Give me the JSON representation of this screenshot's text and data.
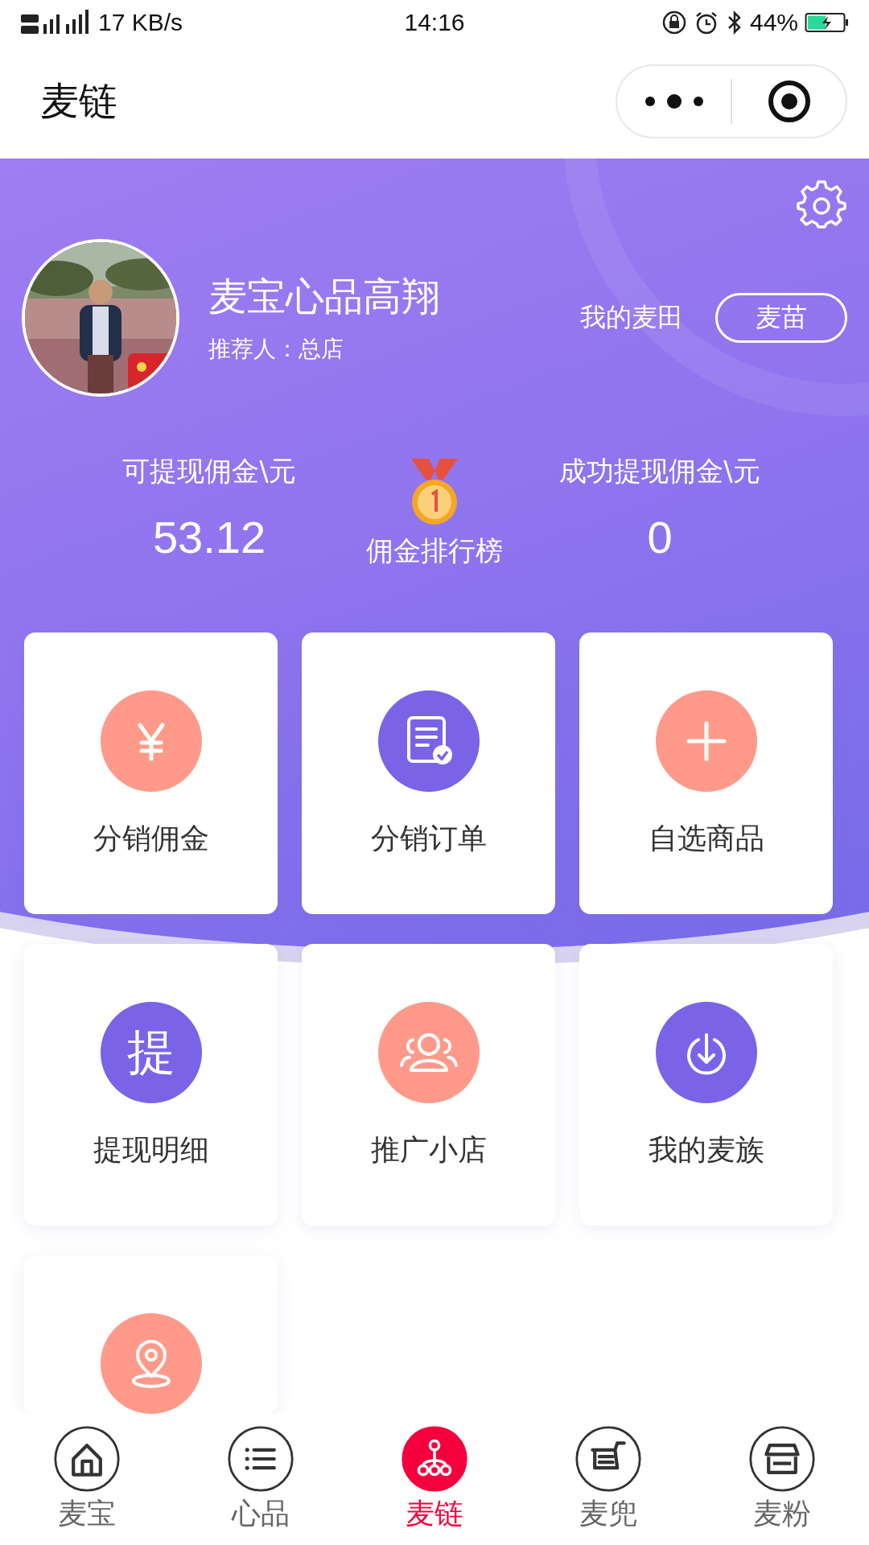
{
  "status_bar": {
    "network": "17 KB/s",
    "time": "14:16",
    "battery": "44%"
  },
  "nav_bar": {
    "title": "麦链"
  },
  "profile": {
    "name": "麦宝心品高翔",
    "referrer": "推荐人：总店",
    "field_label": "我的麦田",
    "level_button": "麦苗"
  },
  "stats": [
    {
      "label": "可提现佣金\\元",
      "value": "53.12"
    },
    {
      "label": "成功提现佣金\\元",
      "value": "0"
    }
  ],
  "ranking": {
    "label": "佣金排行榜"
  },
  "cards": [
    {
      "label": "分销佣金",
      "color": "#ff9a8a"
    },
    {
      "label": "分销订单",
      "color": "#7b63e8"
    },
    {
      "label": "自选商品",
      "color": "#ff9a8a"
    },
    {
      "label": "提现明细",
      "color": "#7b63e8",
      "icon_text": "提"
    },
    {
      "label": "推广小店",
      "color": "#ff9a8a"
    },
    {
      "label": "我的麦族",
      "color": "#7b63e8"
    },
    {
      "color": "#ff9a8a"
    }
  ],
  "tab_bar": [
    {
      "label": "麦宝",
      "selected": false
    },
    {
      "label": "心品",
      "selected": false
    },
    {
      "label": "麦链",
      "selected": true
    },
    {
      "label": "麦兜",
      "selected": false
    },
    {
      "label": "麦粉",
      "selected": false
    }
  ]
}
